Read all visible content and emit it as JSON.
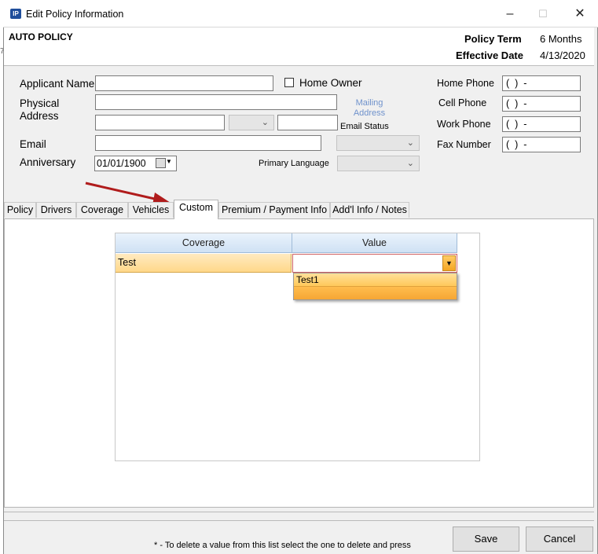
{
  "window": {
    "title": "Edit Policy Information",
    "icon": "IP",
    "minimize": "–",
    "maximize": "☐",
    "close": "✕"
  },
  "header": {
    "policy_type": "AUTO POLICY",
    "policy_term_label": "Policy Term",
    "policy_term_value": "6 Months",
    "effective_date_label": "Effective Date",
    "effective_date_value": "4/13/2020"
  },
  "form": {
    "applicant_name_label": "Applicant Name",
    "applicant_name_value": "",
    "home_owner_label": "Home Owner",
    "home_owner_checked": false,
    "physical_label_1": "Physical",
    "physical_label_2": "Address",
    "address_line1": "",
    "city": "",
    "state": "",
    "zip": "",
    "mailing_line1": "Mailing",
    "mailing_line2": "Address",
    "email_status_label": "Email Status",
    "email_status_value": "",
    "email_label": "Email",
    "email_value": "",
    "anniversary_label": "Anniversary",
    "anniversary_value": "01/01/1900",
    "primary_language_label": "Primary Language",
    "primary_language_value": ""
  },
  "phones": {
    "home_label": "Home Phone",
    "home_value": "(  )  -",
    "cell_label": "Cell Phone",
    "cell_value": "(  )  -",
    "work_label": "Work Phone",
    "work_value": "(  )  -",
    "fax_label": "Fax Number",
    "fax_value": "(  )  -"
  },
  "tabs": [
    "Policy",
    "Drivers",
    "Coverage",
    "Vehicles",
    "Custom",
    "Premium / Payment Info",
    "Add'l Info / Notes"
  ],
  "active_tab": "Custom",
  "grid": {
    "columns": [
      "Coverage",
      "Value"
    ],
    "rows": [
      {
        "coverage": "Test",
        "value": ""
      }
    ],
    "dropdown_options": [
      "Test1",
      ""
    ]
  },
  "footer": {
    "note": "* - To delete a value from this list select the one to delete and press",
    "save_label": "Save",
    "cancel_label": "Cancel"
  },
  "colors": {
    "accent_arrow": "#b01c1c",
    "selection": "#ffd88a",
    "link": "#6f92cc"
  },
  "icons": [
    "app-icon",
    "minimize-icon",
    "maximize-icon",
    "close-icon",
    "chevron-down-icon",
    "calendar-icon",
    "arrow-annotation"
  ]
}
